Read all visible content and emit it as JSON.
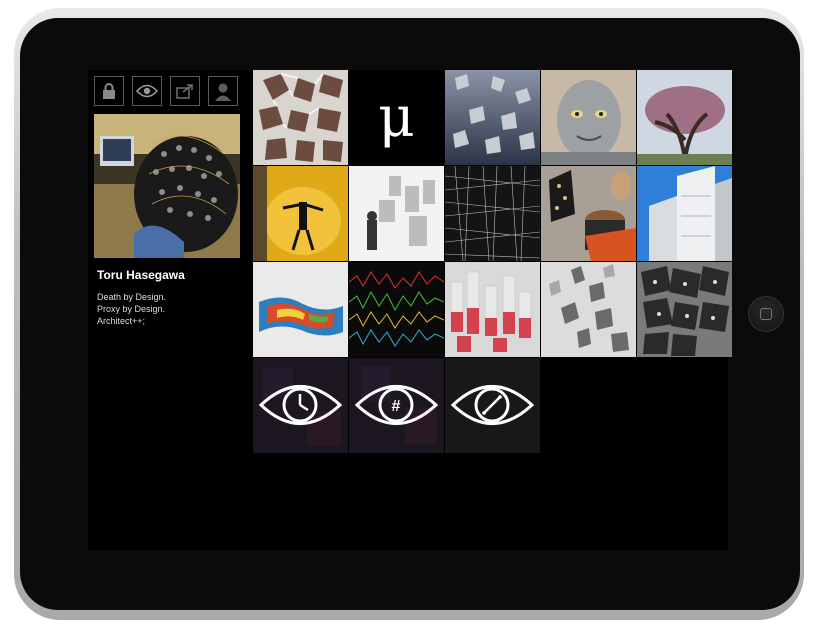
{
  "profile": {
    "name": "Toru Hasegawa",
    "bio": [
      "Death by Design.",
      "Proxy by Design.",
      "Architect++;"
    ]
  },
  "toolbar": {
    "icons": [
      "lock-icon",
      "eye-icon",
      "share-icon",
      "user-icon"
    ]
  },
  "grid": {
    "mu_symbol": "μ",
    "eye_tiles": [
      {
        "icon": "eye-clock-icon"
      },
      {
        "icon": "eye-hash-icon",
        "symbol": "#"
      },
      {
        "icon": "eye-compass-icon"
      }
    ]
  },
  "colors": {
    "screen_bg": "#000000",
    "bezel": "#0b0b0b",
    "frame": "#bdbdbd"
  }
}
